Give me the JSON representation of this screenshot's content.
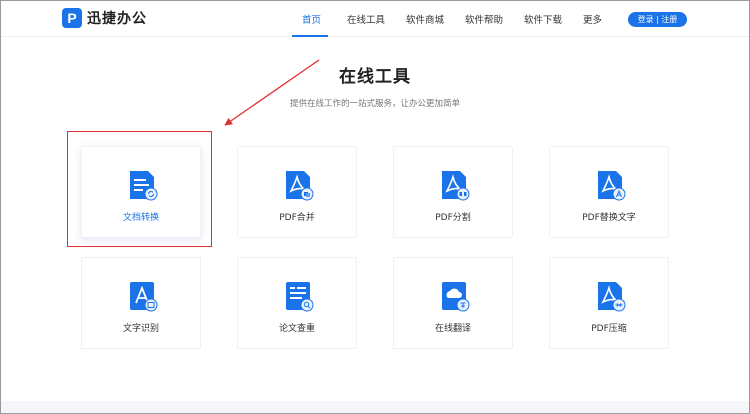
{
  "brand": {
    "logo_letter": "P",
    "name": "迅捷办公"
  },
  "nav": {
    "items": [
      {
        "label": "首页",
        "active": true
      },
      {
        "label": "在线工具",
        "active": false
      },
      {
        "label": "软件商城",
        "active": false
      },
      {
        "label": "软件帮助",
        "active": false
      },
      {
        "label": "软件下载",
        "active": false
      },
      {
        "label": "更多",
        "active": false
      }
    ],
    "login_label": "登录 | 注册"
  },
  "page": {
    "title": "在线工具",
    "subtitle": "提供在线工作的一站式服务，让办公更加简单"
  },
  "tools": [
    {
      "label": "文档转换",
      "icon": "doc-convert-icon"
    },
    {
      "label": "PDF合并",
      "icon": "pdf-merge-icon"
    },
    {
      "label": "PDF分割",
      "icon": "pdf-split-icon"
    },
    {
      "label": "PDF替换文字",
      "icon": "pdf-replace-text-icon"
    },
    {
      "label": "文字识别",
      "icon": "ocr-icon"
    },
    {
      "label": "论文查重",
      "icon": "paper-check-icon"
    },
    {
      "label": "在线翻译",
      "icon": "translate-icon"
    },
    {
      "label": "PDF压缩",
      "icon": "pdf-compress-icon"
    }
  ],
  "colors": {
    "accent": "#1a73e8",
    "annotation": "#e03030"
  }
}
